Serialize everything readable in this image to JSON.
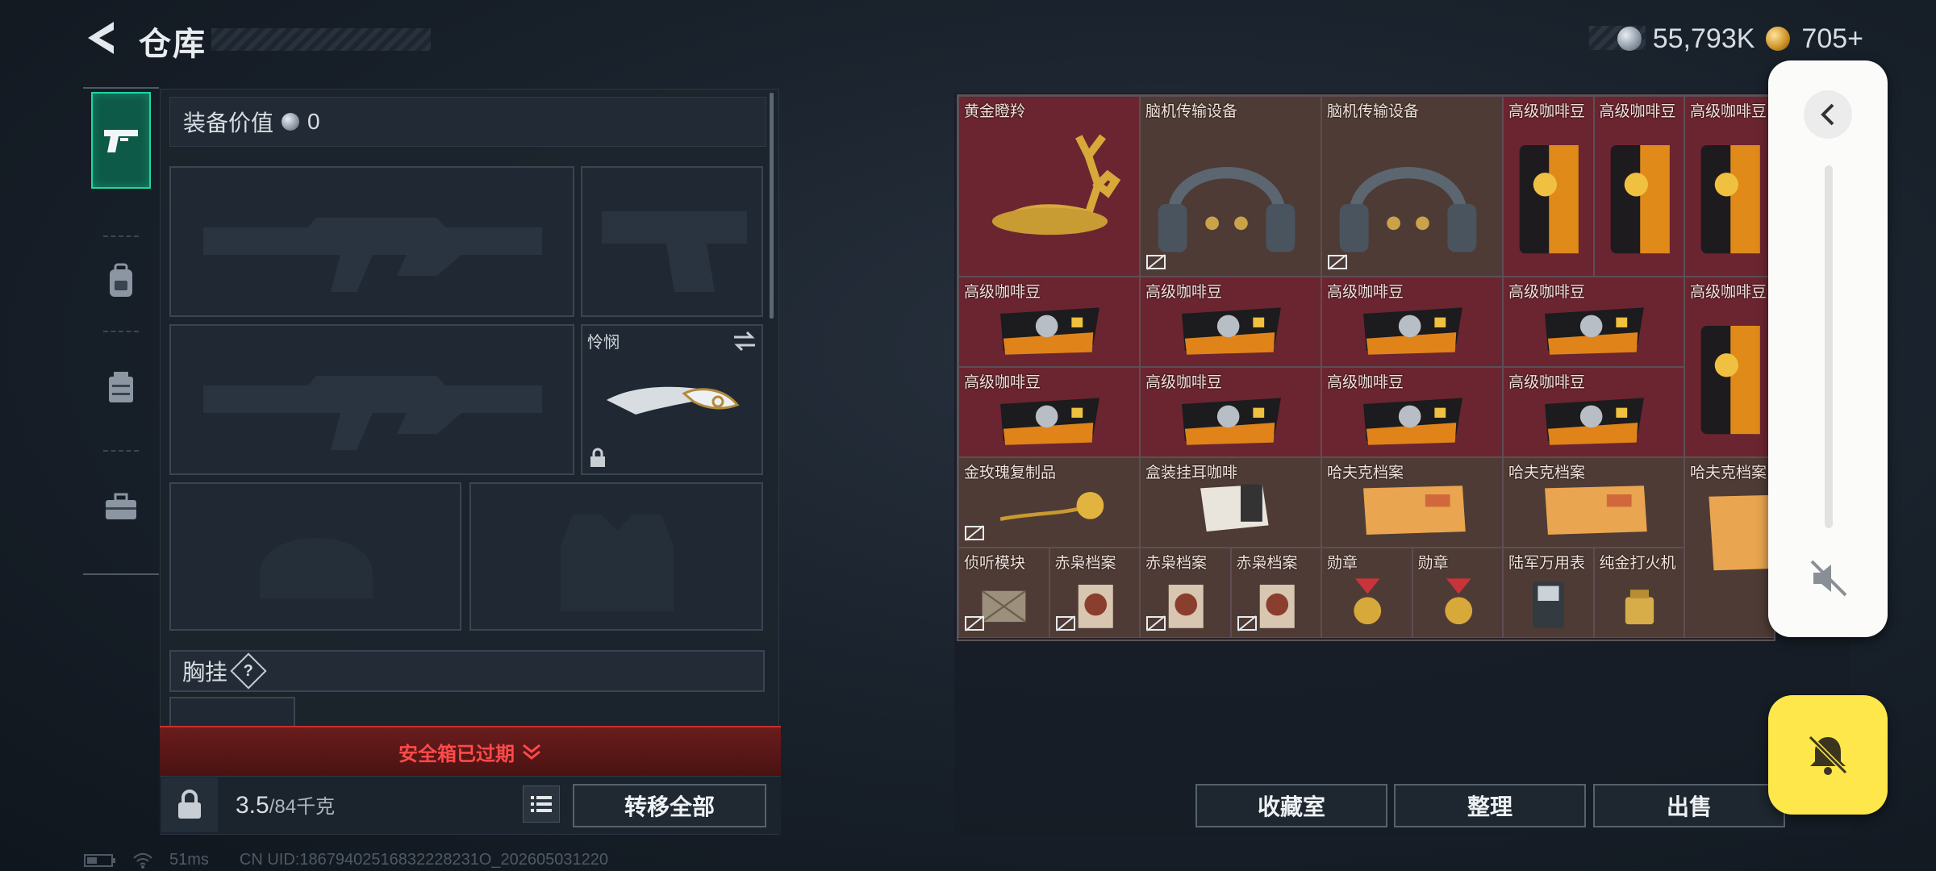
{
  "header": {
    "title": "仓库",
    "currency_silver": "55,793K",
    "currency_gold": "705",
    "currency_plus": "+"
  },
  "equipment": {
    "value_label": "装备价值",
    "value": "0",
    "melee_label": "怜悯",
    "chest_rig_label": "胸挂",
    "chest_rig_help": "?",
    "safe_box_status": "安全箱已过期"
  },
  "footer_left": {
    "weight_current": "3.5",
    "weight_max": "/84千克",
    "transfer_all": "转移全部"
  },
  "inventory": {
    "items": [
      {
        "label": "黄金瞪羚",
        "bg": "red"
      },
      {
        "label": "脑机传输设备",
        "bg": "brown"
      },
      {
        "label": "脑机传输设备",
        "bg": "brown"
      },
      {
        "label": "高级咖啡豆",
        "bg": "red"
      },
      {
        "label": "高级咖啡豆",
        "bg": "red"
      },
      {
        "label": "高级咖啡豆",
        "bg": "red"
      },
      {
        "label": "高级咖啡豆",
        "bg": "red"
      },
      {
        "label": "高级咖啡豆",
        "bg": "red"
      },
      {
        "label": "高级咖啡豆",
        "bg": "red"
      },
      {
        "label": "高级咖啡豆",
        "bg": "red"
      },
      {
        "label": "高级咖啡豆",
        "bg": "red"
      },
      {
        "label": "高级咖啡豆",
        "bg": "red"
      },
      {
        "label": "高级咖啡豆",
        "bg": "red"
      },
      {
        "label": "高级咖啡豆",
        "bg": "red"
      },
      {
        "label": "高级咖啡豆",
        "bg": "red"
      },
      {
        "label": "金玫瑰复制品",
        "bg": "brown"
      },
      {
        "label": "盒装挂耳咖啡",
        "bg": "brown"
      },
      {
        "label": "哈夫克档案",
        "bg": "brown"
      },
      {
        "label": "哈夫克档案",
        "bg": "brown"
      },
      {
        "label": "哈夫克档案",
        "bg": "brown"
      },
      {
        "label": "侦听模块",
        "bg": "brown"
      },
      {
        "label": "赤枭档案",
        "bg": "brown"
      },
      {
        "label": "赤枭档案",
        "bg": "brown"
      },
      {
        "label": "赤枭档案",
        "bg": "brown"
      },
      {
        "label": "勋章",
        "bg": "brown"
      },
      {
        "label": "勋章",
        "bg": "brown"
      },
      {
        "label": "陆军万用表",
        "bg": "brown"
      },
      {
        "label": "纯金打火机",
        "bg": "brown"
      }
    ]
  },
  "footer_right": {
    "collection_room": "收藏室",
    "organize": "整理",
    "sell": "出售"
  },
  "status": {
    "ping": "51ms",
    "uid": "CN UID:18679402516832228231O_202605031220"
  },
  "colors": {
    "accent_green": "#1fd6a0",
    "warning_red": "#ff4a4a",
    "item_red_bg": "#6b2530",
    "item_brown_bg": "#4e3b35",
    "float_yellow": "#fde74a"
  }
}
